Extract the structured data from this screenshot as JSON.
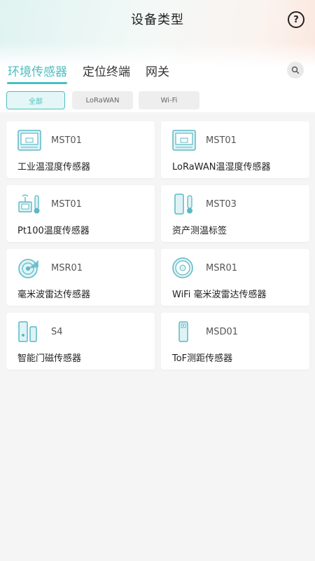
{
  "header": {
    "title": "设备类型",
    "help_icon": "help-circle-icon"
  },
  "tabs": [
    {
      "label": "环境传感器",
      "active": true
    },
    {
      "label": "定位终端",
      "active": false
    },
    {
      "label": "网关",
      "active": false
    }
  ],
  "search": {
    "icon": "search-icon"
  },
  "filters": [
    {
      "label": "全部",
      "active": true
    },
    {
      "label": "LoRaWAN",
      "active": false
    },
    {
      "label": "Wi-Fi",
      "active": false
    }
  ],
  "devices": [
    {
      "model": "MST01",
      "name": "工业温湿度传感器",
      "icon": "panel-sensor-icon"
    },
    {
      "model": "MST01",
      "name": "LoRaWAN温湿度传感器",
      "icon": "panel-sensor-icon"
    },
    {
      "model": "MST01",
      "name": "Pt100温度传感器",
      "icon": "pt100-probe-icon"
    },
    {
      "model": "MST03",
      "name": "资产测温标签",
      "icon": "asset-tag-icon"
    },
    {
      "model": "MSR01",
      "name": "毫米波雷达传感器",
      "icon": "radar-icon"
    },
    {
      "model": "MSR01",
      "name": "WiFi 毫米波雷达传感器",
      "icon": "round-radar-icon"
    },
    {
      "model": "S4",
      "name": "智能门磁传感器",
      "icon": "door-magnet-icon"
    },
    {
      "model": "MSD01",
      "name": "ToF测距传感器",
      "icon": "tof-sensor-icon"
    }
  ],
  "colors": {
    "accent": "#4fbdc0",
    "icon_stroke": "#5bb8c6",
    "icon_fill": "#dff3f5"
  }
}
